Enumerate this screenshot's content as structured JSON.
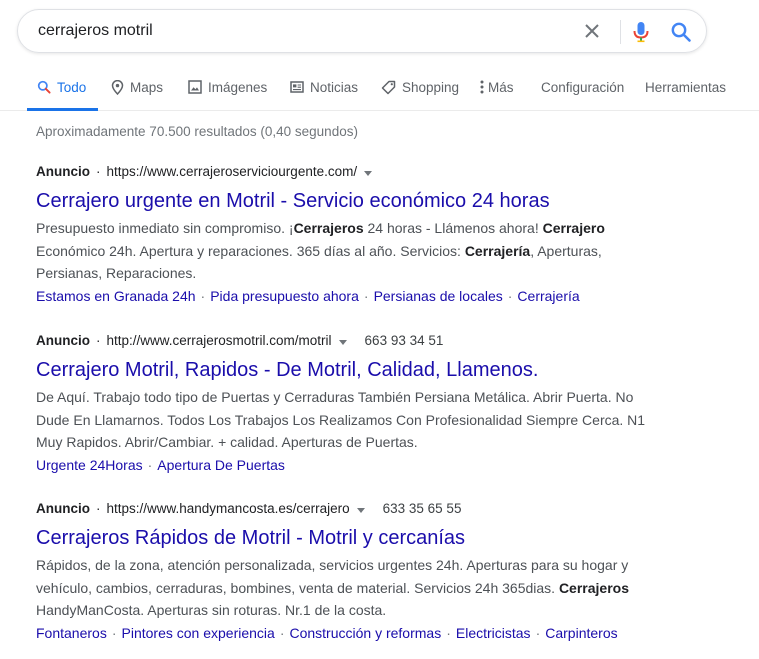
{
  "search": {
    "query": "cerrajeros motril"
  },
  "tabs": [
    {
      "label": "Todo",
      "icon": "search-icon"
    },
    {
      "label": "Maps",
      "icon": "map-pin-icon"
    },
    {
      "label": "Imágenes",
      "icon": "image-icon"
    },
    {
      "label": "Noticias",
      "icon": "news-icon"
    },
    {
      "label": "Shopping",
      "icon": "tag-icon"
    },
    {
      "label": "Más",
      "icon": "more-vert-icon"
    },
    {
      "label": "Configuración"
    },
    {
      "label": "Herramientas"
    }
  ],
  "stats": "Aproximadamente 70.500 resultados (0,40 segundos)",
  "ads": [
    {
      "label": "Anuncio",
      "dot": "·",
      "url": "https://www.cerrajeroserviciourgente.com/",
      "phone": "",
      "title": "Cerrajero urgente en Motril - Servicio económico 24 horas",
      "desc": [
        {
          "t": "Presupuesto inmediato sin compromiso. ¡"
        },
        {
          "t": "Cerrajeros",
          "b": true
        },
        {
          "t": " 24 horas - Llámenos ahora! "
        },
        {
          "t": "Cerrajero",
          "b": true
        },
        {
          "t": " Económico 24h. Apertura y reparaciones. 365 días al año. Servicios: "
        },
        {
          "t": "Cerrajería",
          "b": true
        },
        {
          "t": ", Aperturas, Persianas, Reparaciones."
        }
      ],
      "links": [
        "Estamos en Granada 24h",
        "Pida presupuesto ahora",
        "Persianas de locales",
        "Cerrajería"
      ]
    },
    {
      "label": "Anuncio",
      "dot": "·",
      "url": "http://www.cerrajerosmotril.com/motril",
      "phone": "663 93 34 51",
      "title": "Cerrajero Motril, Rapidos - De Motril, Calidad, Llamenos.",
      "desc": [
        {
          "t": "De Aquí. Trabajo todo tipo de Puertas y Cerraduras También Persiana Metálica. Abrir Puerta. No Dude En Llamarnos. Todos Los Trabajos Los Realizamos Con Profesionalidad Siempre Cerca. N1 Muy Rapidos. Abrir/Cambiar. + calidad. Aperturas de Puertas."
        }
      ],
      "links": [
        "Urgente 24Horas",
        "Apertura De Puertas"
      ]
    },
    {
      "label": "Anuncio",
      "dot": "·",
      "url": "https://www.handymancosta.es/cerrajero",
      "phone": "633 35 65 55",
      "title": "Cerrajeros Rápidos de Motril - Motril y cercanías",
      "desc": [
        {
          "t": "Rápidos, de la zona, atención personalizada, servicios urgentes 24h. Aperturas para su hogar y vehículo, cambios, cerraduras, bombines, venta de material. Servicios 24h 365dias. "
        },
        {
          "t": "Cerrajeros",
          "b": true
        },
        {
          "t": " HandyManCosta. Aperturas sin roturas. Nr.1 de la costa."
        }
      ],
      "links": [
        "Fontaneros",
        "Pintores con experiencia",
        "Construcción y reformas",
        "Electricistas",
        "Carpinteros"
      ]
    }
  ],
  "colors": {
    "accent": "#1a73e8",
    "link": "#1a0dab",
    "muted": "#70757a",
    "text": "#4d5156"
  }
}
